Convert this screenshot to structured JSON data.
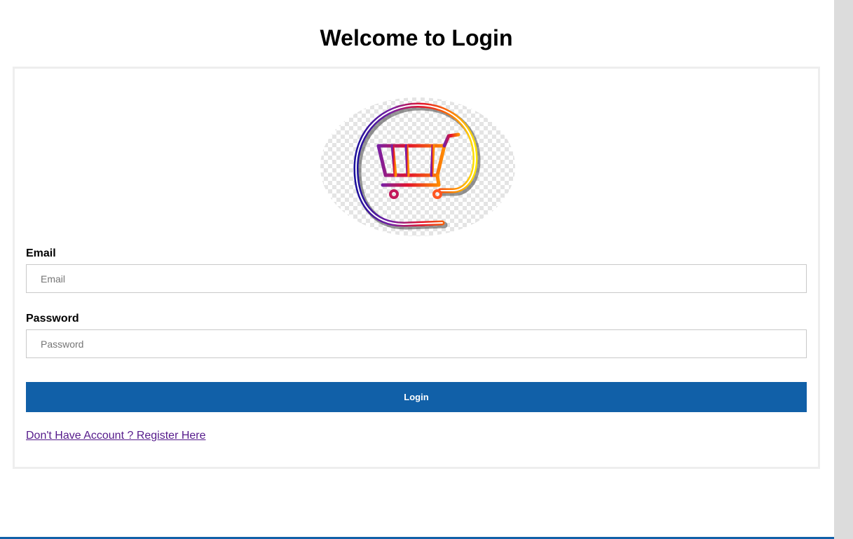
{
  "page": {
    "title": "Welcome to Login"
  },
  "form": {
    "email_label": "Email",
    "email_placeholder": "Email",
    "email_value": "",
    "password_label": "Password",
    "password_placeholder": "Password",
    "password_value": "",
    "login_button": "Login",
    "register_link": "Don't Have Account ? Register Here"
  },
  "logo": {
    "icon": "shopping-cart-icon"
  },
  "colors": {
    "primary": "#1160a8",
    "visited_link": "#551a8b",
    "card_border": "#eeeeee",
    "input_border": "#c9c9c9"
  }
}
